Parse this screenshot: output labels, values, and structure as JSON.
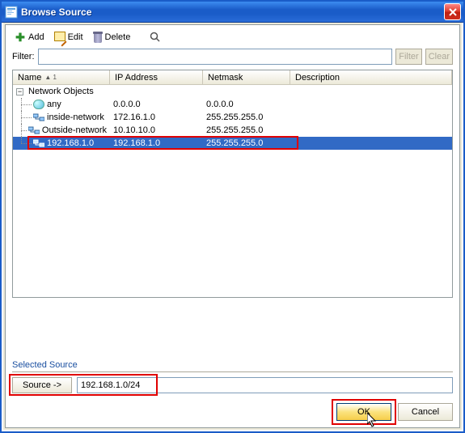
{
  "window": {
    "title": "Browse Source"
  },
  "toolbar": {
    "add_label": "Add",
    "edit_label": "Edit",
    "delete_label": "Delete"
  },
  "filter": {
    "label": "Filter:",
    "value": "",
    "filter_btn": "Filter",
    "clear_btn": "Clear"
  },
  "columns": {
    "name": "Name",
    "sort_indicator": "▲ 1",
    "ip": "IP Address",
    "netmask": "Netmask",
    "description": "Description"
  },
  "tree": {
    "group": "Network Objects",
    "rows": [
      {
        "name": "any",
        "ip": "0.0.0.0",
        "netmask": "0.0.0.0",
        "desc": "",
        "icon": "any"
      },
      {
        "name": "inside-network",
        "ip": "172.16.1.0",
        "netmask": "255.255.255.0",
        "desc": "",
        "icon": "net"
      },
      {
        "name": "Outside-network",
        "ip": "10.10.10.0",
        "netmask": "255.255.255.0",
        "desc": "",
        "icon": "net"
      },
      {
        "name": "192.168.1.0",
        "ip": "192.168.1.0",
        "netmask": "255.255.255.0",
        "desc": "",
        "icon": "net",
        "selected": true
      }
    ]
  },
  "selected_source": {
    "section_label": "Selected Source",
    "button_label": "Source ->",
    "value": "192.168.1.0/24"
  },
  "buttons": {
    "ok": "OK",
    "cancel": "Cancel"
  }
}
